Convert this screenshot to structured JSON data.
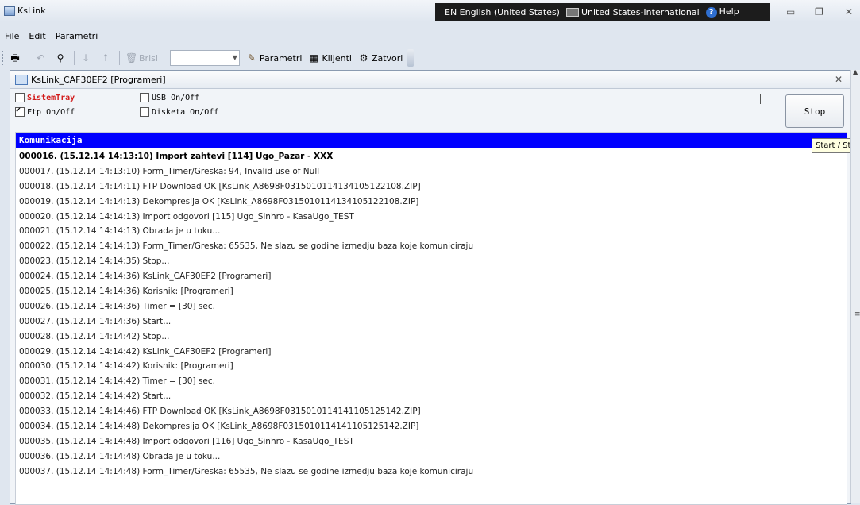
{
  "window": {
    "title": "KsLink"
  },
  "langbar": {
    "lang": "EN English (United States)",
    "keyboard": "United States-International",
    "help": "Help"
  },
  "menu": [
    "File",
    "Edit",
    "Parametri"
  ],
  "toolbar": {
    "brisi": "Brisi",
    "parametri": "Parametri",
    "klijenti": "Klijenti",
    "zatvori": "Zatvori",
    "combo_value": ""
  },
  "child": {
    "title": "KsLink_CAF30EF2 [Programeri]",
    "options": {
      "sistemtray": "SistemTray",
      "usb": "USB On/Off",
      "ftp": "Ftp On/Off",
      "disketa": "Disketa On/Off"
    },
    "stop_label": "Stop",
    "tooltip": "Start / Sto",
    "log_header": "Komunikacija",
    "log": [
      "000016. (15.12.14 14:13:10) Import zahtevi [114] Ugo_Pazar - XXX",
      "000017. (15.12.14 14:13:10) Form_Timer/Greska: 94, Invalid use of Null",
      "000018. (15.12.14 14:14:11) FTP Download OK [KsLink_A8698F0315010114134105122108.ZIP]",
      "000019. (15.12.14 14:14:13) Dekompresija OK [KsLink_A8698F0315010114134105122108.ZIP]",
      "000020. (15.12.14 14:14:13) Import odgovori [115] Ugo_Sinhro - KasaUgo_TEST",
      "000021. (15.12.14 14:14:13) Obrada je u toku...",
      "000022. (15.12.14 14:14:13) Form_Timer/Greska: 65535, Ne slazu se godine izmedju baza koje komuniciraju",
      "000023. (15.12.14 14:14:35) Stop...",
      "000024. (15.12.14 14:14:36) KsLink_CAF30EF2 [Programeri]",
      "000025. (15.12.14 14:14:36) Korisnik: [Programeri]",
      "000026. (15.12.14 14:14:36) Timer = [30] sec.",
      "000027. (15.12.14 14:14:36) Start...",
      "000028. (15.12.14 14:14:42) Stop...",
      "000029. (15.12.14 14:14:42) KsLink_CAF30EF2 [Programeri]",
      "000030. (15.12.14 14:14:42) Korisnik: [Programeri]",
      "000031. (15.12.14 14:14:42) Timer = [30] sec.",
      "000032. (15.12.14 14:14:42) Start...",
      "000033. (15.12.14 14:14:46) FTP Download OK [KsLink_A8698F0315010114141105125142.ZIP]",
      "000034. (15.12.14 14:14:48) Dekompresija OK [KsLink_A8698F0315010114141105125142.ZIP]",
      "000035. (15.12.14 14:14:48) Import odgovori [116] Ugo_Sinhro - KasaUgo_TEST",
      "000036. (15.12.14 14:14:48) Obrada je u toku...",
      "000037. (15.12.14 14:14:48) Form_Timer/Greska: 65535, Ne slazu se godine izmedju baza koje komuniciraju"
    ]
  },
  "icons": [
    "app-icon",
    "print-icon",
    "undo-icon",
    "find-icon",
    "sort-asc-icon",
    "sort-desc-icon",
    "trash-icon",
    "wrench-icon",
    "table-icon",
    "exit-icon",
    "close-icon",
    "minimize-icon",
    "maximize-icon"
  ]
}
